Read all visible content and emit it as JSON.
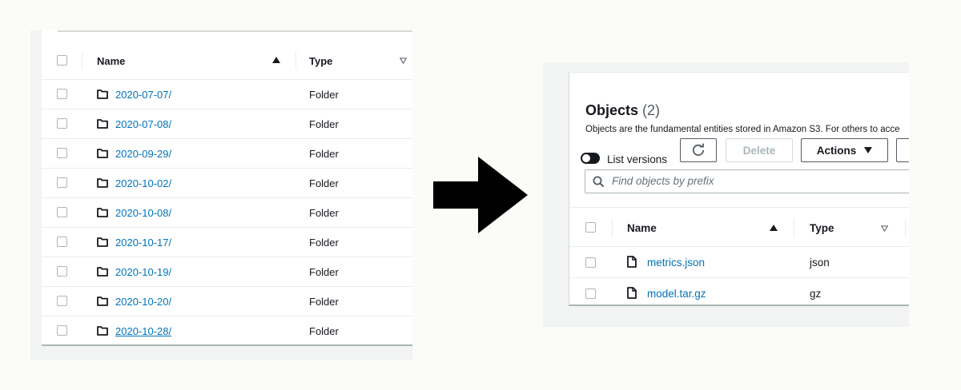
{
  "left_table": {
    "headers": {
      "name": "Name",
      "type": "Type"
    },
    "rows": [
      {
        "name": "2020-07-07/",
        "type": "Folder"
      },
      {
        "name": "2020-07-08/",
        "type": "Folder"
      },
      {
        "name": "2020-09-29/",
        "type": "Folder"
      },
      {
        "name": "2020-10-02/",
        "type": "Folder"
      },
      {
        "name": "2020-10-08/",
        "type": "Folder"
      },
      {
        "name": "2020-10-17/",
        "type": "Folder"
      },
      {
        "name": "2020-10-19/",
        "type": "Folder"
      },
      {
        "name": "2020-10-20/",
        "type": "Folder"
      },
      {
        "name": "2020-10-28/",
        "type": "Folder"
      }
    ]
  },
  "objects_panel": {
    "title": "Objects",
    "count": "(2)",
    "description": "Objects are the fundamental entities stored in Amazon S3. For others to acce",
    "list_versions_label": "List versions",
    "delete_label": "Delete",
    "actions_label": "Actions",
    "search_placeholder": "Find objects by prefix",
    "headers": {
      "name": "Name",
      "type": "Type"
    },
    "rows": [
      {
        "name": "metrics.json",
        "type": "json"
      },
      {
        "name": "model.tar.gz",
        "type": "gz"
      }
    ]
  },
  "icons": {
    "folder": "folder-icon",
    "file": "file-icon",
    "refresh": "refresh-icon",
    "search": "search-icon",
    "arrow": "right-arrow-icon",
    "sort_asc": "sort-ascending-icon",
    "sort_none": "sort-descending-outline-icon",
    "dropdown": "caret-down-icon"
  },
  "colors": {
    "link": "#0073bb",
    "text": "#16191f",
    "border": "#aab7b8",
    "background": "#f2f3f3"
  }
}
